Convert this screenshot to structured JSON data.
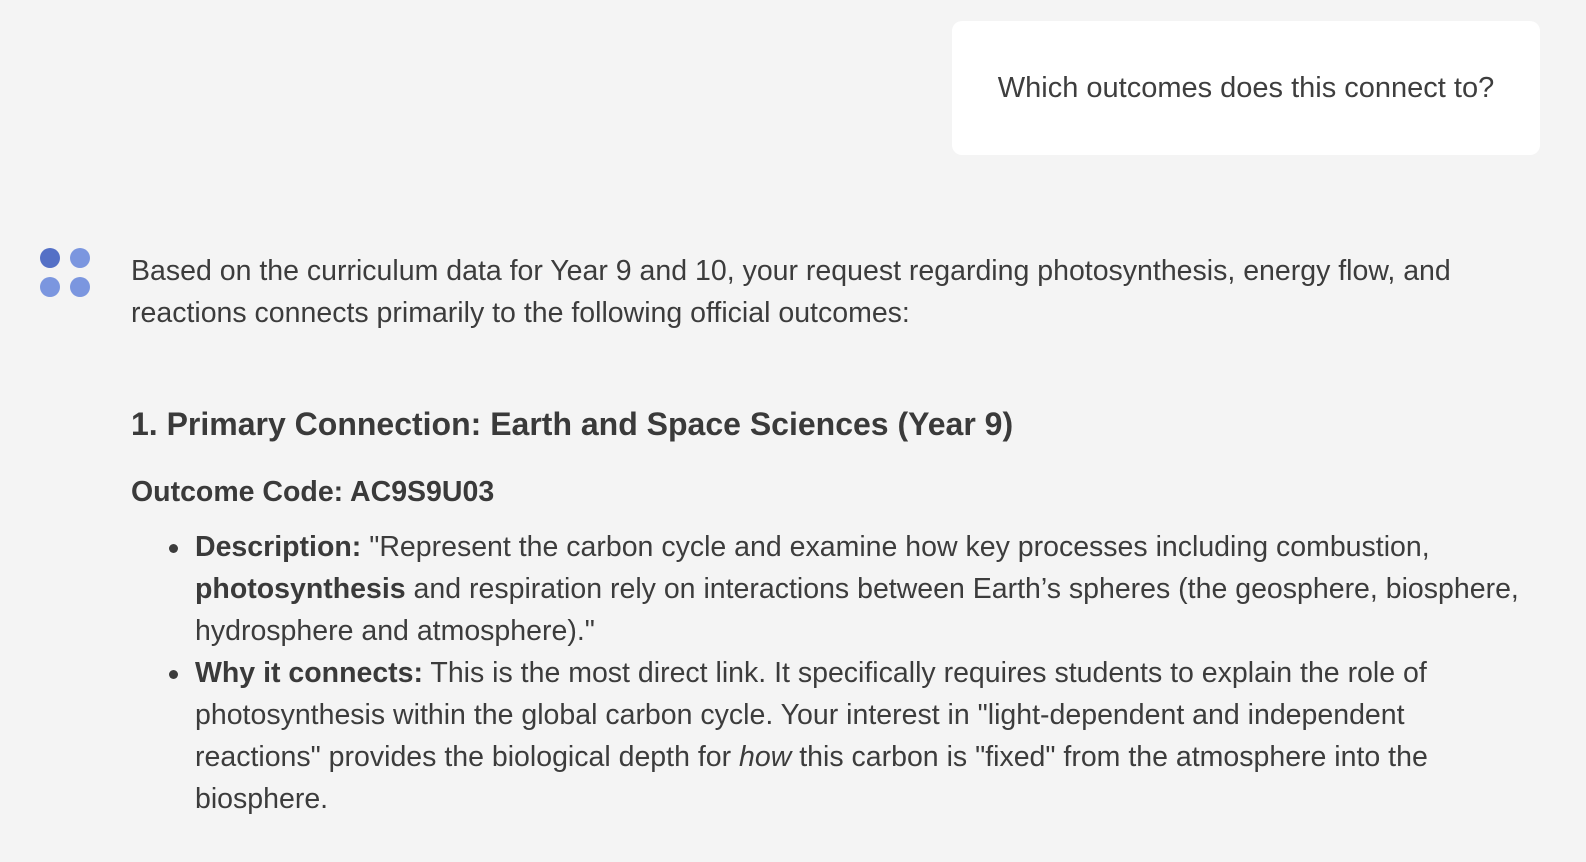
{
  "user_message": {
    "text": "Which outcomes does this connect to?"
  },
  "assistant": {
    "avatar_icon": "four-dot-logo-icon",
    "avatar_colors": [
      "#5470c6",
      "#7b96df"
    ],
    "intro": "Based on the curriculum data for Year 9 and 10, your request regarding photosynthesis, energy flow, and reactions connects primarily to the following official outcomes:",
    "section": {
      "title": "1. Primary Connection: Earth and Space Sciences (Year 9)",
      "outcome_code": "Outcome Code: AC9S9U03",
      "bullets": [
        {
          "label": "Description:",
          "text_1": " \"Represent the carbon cycle and examine how key processes including combustion, ",
          "bold_inline": "photosynthesis",
          "text_2": " and respiration rely on interactions between Earth’s spheres (the geosphere, biosphere, hydrosphere and atmosphere).\""
        },
        {
          "label": "Why it connects:",
          "text_1": " This is the most direct link. It specifically requires students to explain the role of photosynthesis within the global carbon cycle. Your interest in \"light-dependent and independent reactions\" provides the biological depth for ",
          "italic_inline": "how",
          "text_2": " this carbon is \"fixed\" from the atmosphere into the biosphere."
        }
      ]
    }
  }
}
